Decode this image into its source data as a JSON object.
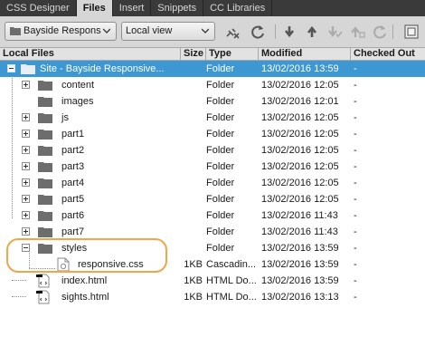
{
  "tabs": [
    {
      "label": "CSS Designer",
      "active": false
    },
    {
      "label": "Files",
      "active": true
    },
    {
      "label": "Insert",
      "active": false
    },
    {
      "label": "Snippets",
      "active": false
    },
    {
      "label": "CC Libraries",
      "active": false
    }
  ],
  "toolbar": {
    "site_select": "Bayside Respons",
    "view_select": "Local view",
    "icons": [
      "disconnect-icon",
      "refresh-icon",
      "get-files-icon",
      "put-files-icon",
      "check-out-icon",
      "check-in-icon",
      "synchronize-icon",
      "expand-icon"
    ]
  },
  "columns": {
    "name": "Local Files",
    "size": "Size",
    "type": "Type",
    "modified": "Modified",
    "checked_out": "Checked Out"
  },
  "rows": [
    {
      "name": "Site - Bayside Responsive...",
      "size": "",
      "type": "Folder",
      "modified": "13/02/2016 13:59",
      "checked_out": "-",
      "kind": "site",
      "selected": true
    },
    {
      "name": "content",
      "size": "",
      "type": "Folder",
      "modified": "13/02/2016 12:05",
      "checked_out": "-",
      "kind": "folder"
    },
    {
      "name": "images",
      "size": "",
      "type": "Folder",
      "modified": "13/02/2016 12:01",
      "checked_out": "-",
      "kind": "folder"
    },
    {
      "name": "js",
      "size": "",
      "type": "Folder",
      "modified": "13/02/2016 12:05",
      "checked_out": "-",
      "kind": "folder"
    },
    {
      "name": "part1",
      "size": "",
      "type": "Folder",
      "modified": "13/02/2016 12:05",
      "checked_out": "-",
      "kind": "folder"
    },
    {
      "name": "part2",
      "size": "",
      "type": "Folder",
      "modified": "13/02/2016 12:05",
      "checked_out": "-",
      "kind": "folder"
    },
    {
      "name": "part3",
      "size": "",
      "type": "Folder",
      "modified": "13/02/2016 12:05",
      "checked_out": "-",
      "kind": "folder"
    },
    {
      "name": "part4",
      "size": "",
      "type": "Folder",
      "modified": "13/02/2016 12:05",
      "checked_out": "-",
      "kind": "folder"
    },
    {
      "name": "part5",
      "size": "",
      "type": "Folder",
      "modified": "13/02/2016 12:05",
      "checked_out": "-",
      "kind": "folder"
    },
    {
      "name": "part6",
      "size": "",
      "type": "Folder",
      "modified": "13/02/2016 11:43",
      "checked_out": "-",
      "kind": "folder"
    },
    {
      "name": "part7",
      "size": "",
      "type": "Folder",
      "modified": "13/02/2016 11:43",
      "checked_out": "-",
      "kind": "folder"
    },
    {
      "name": "styles",
      "size": "",
      "type": "Folder",
      "modified": "13/02/2016 13:59",
      "checked_out": "-",
      "kind": "folder-open"
    },
    {
      "name": "responsive.css",
      "size": "1KB",
      "type": "Cascadin...",
      "modified": "13/02/2016 13:59",
      "checked_out": "-",
      "kind": "css"
    },
    {
      "name": "index.html",
      "size": "1KB",
      "type": "HTML Do...",
      "modified": "13/02/2016 13:59",
      "checked_out": "-",
      "kind": "html"
    },
    {
      "name": "sights.html",
      "size": "1KB",
      "type": "HTML Do...",
      "modified": "13/02/2016 13:13",
      "checked_out": "-",
      "kind": "html"
    }
  ],
  "colors": {
    "selection": "#3d97d3",
    "highlight_ring": "#f0a64a",
    "tab_bar": "#3a3a3a"
  }
}
